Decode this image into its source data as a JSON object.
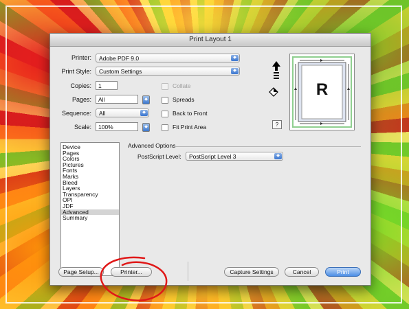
{
  "window": {
    "title": "Print Layout 1"
  },
  "printer": {
    "label": "Printer:",
    "value": "Adobe PDF 9.0"
  },
  "print_style": {
    "label": "Print Style:",
    "value": "Custom Settings"
  },
  "copies": {
    "label": "Copies:",
    "value": "1"
  },
  "pages": {
    "label": "Pages:",
    "value": "All"
  },
  "sequence": {
    "label": "Sequence:",
    "value": "All"
  },
  "scale": {
    "label": "Scale:",
    "value": "100%"
  },
  "checkboxes": {
    "collate": "Collate",
    "spreads": "Spreads",
    "back_to_front": "Back to Front",
    "fit_print_area": "Fit Print Area"
  },
  "preview": {
    "page_letter": "R",
    "help": "?"
  },
  "sidebar": {
    "items": [
      "Device",
      "Pages",
      "Colors",
      "Pictures",
      "Fonts",
      "Marks",
      "Bleed",
      "Layers",
      "Transparency",
      "OPI",
      "JDF",
      "Advanced",
      "Summary"
    ],
    "selected": "Advanced"
  },
  "advanced": {
    "group_title": "Advanced Options",
    "postscript_label": "PostScript Level:",
    "postscript_value": "PostScript Level 3"
  },
  "buttons": {
    "page_setup": "Page Setup...",
    "printer": "Printer...",
    "capture_settings": "Capture Settings",
    "cancel": "Cancel",
    "print": "Print"
  },
  "colors": {
    "accent": "#3a76d0",
    "annotation_circle": "#e01818"
  }
}
